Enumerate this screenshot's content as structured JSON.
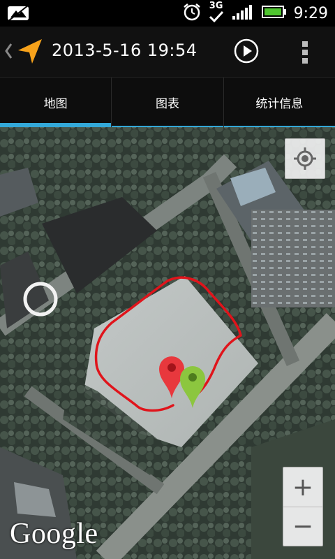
{
  "status_bar": {
    "time": "9:29",
    "network": "3G"
  },
  "action_bar": {
    "title": "2013-5-16 19:54"
  },
  "tabs": [
    {
      "label": "地图"
    },
    {
      "label": "图表"
    },
    {
      "label": "统计信息"
    }
  ],
  "map": {
    "attribution": "Google",
    "zoom_in_label": "+",
    "zoom_out_label": "−",
    "route_color": "#e0141b",
    "start_marker_color": "#e8383d",
    "end_marker_color": "#8cc63f"
  },
  "colors": {
    "accent": "#33a8d8",
    "logo": "#f7a21b"
  }
}
